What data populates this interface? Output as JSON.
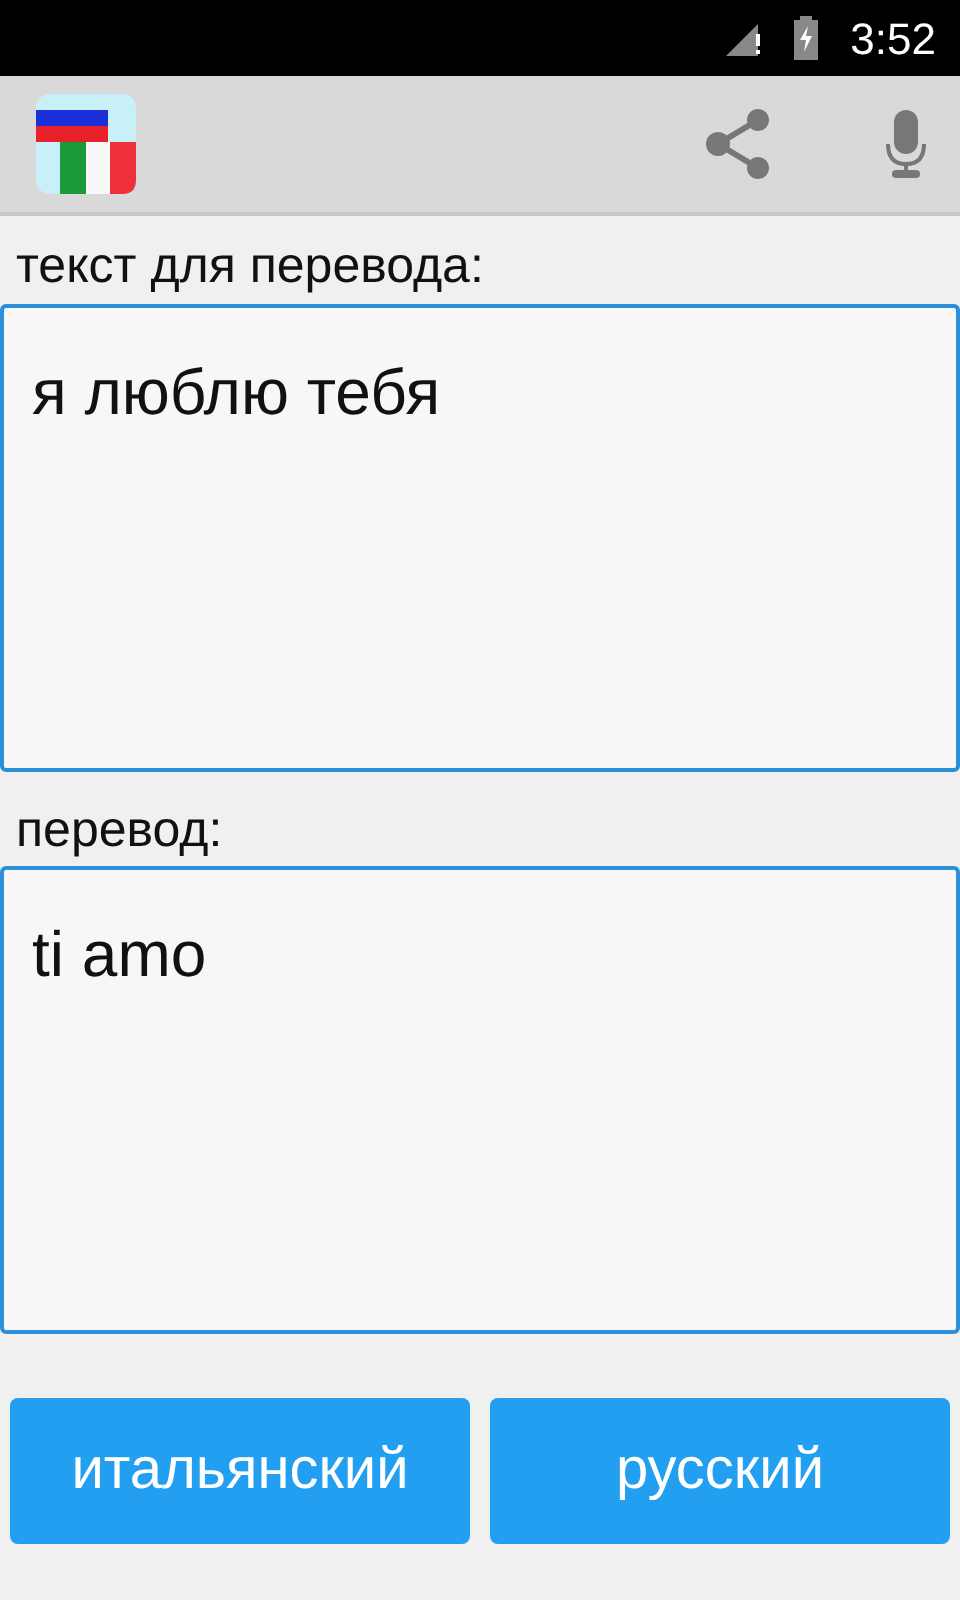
{
  "status_bar": {
    "time": "3:52"
  },
  "source": {
    "label": "текст для перевода:",
    "value": "я люблю тебя"
  },
  "target": {
    "label": "перевод:",
    "value": "ti amo"
  },
  "buttons": [
    {
      "label": "итальянский"
    },
    {
      "label": "русский"
    }
  ]
}
